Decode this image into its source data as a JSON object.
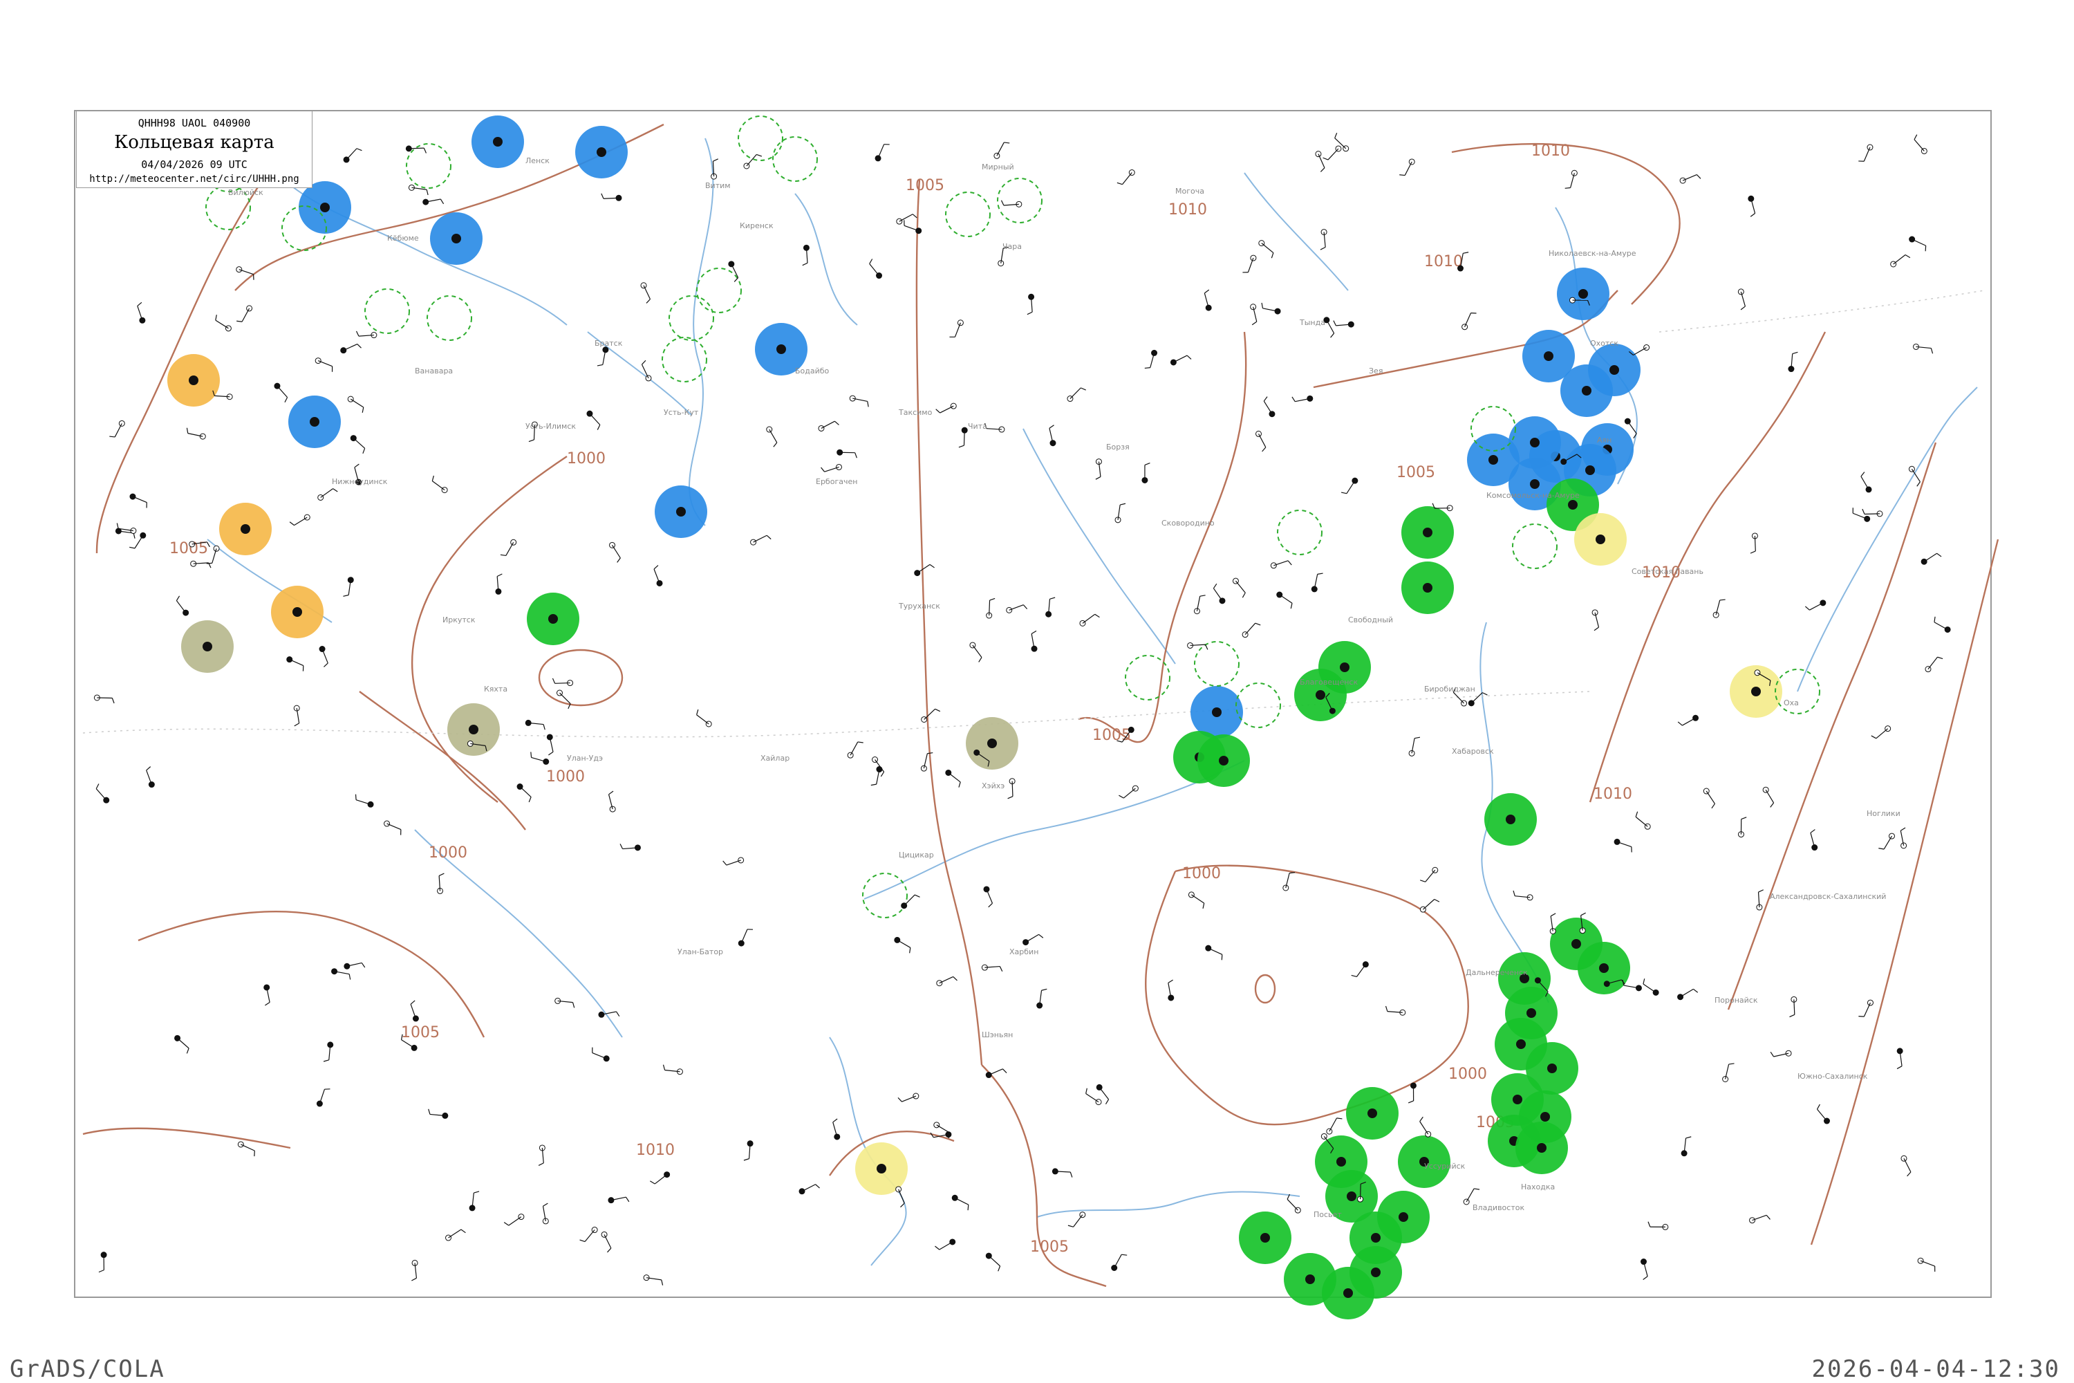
{
  "header": {
    "code_line": "QHHH98  UAOL  040900",
    "title": "Кольцевая карта",
    "date_line": "04/04/2026 09 UTC",
    "url": "http://meteocenter.net/circ/UHHH.png"
  },
  "footer": {
    "left": "GrADS/COLA",
    "right": "2026-04-04-12:30"
  },
  "colors": {
    "isobar": "#b8735a",
    "river": "#8ab8e0",
    "frame": "#999999",
    "circle_blue": "#2b8ce6",
    "circle_green": "#17c22a",
    "circle_orange": "#f5b84a",
    "circle_yellow": "#f4ec8c",
    "circle_olive": "#b7b98e",
    "dashed_green": "#2fae2f"
  },
  "isobar_labels": [
    "1010",
    "1010",
    "1010",
    "1005",
    "1005",
    "1005",
    "1005",
    "1000",
    "1000",
    "1000",
    "1000",
    "1005",
    "1010",
    "1005",
    "1010",
    "1005",
    "1000",
    "1010"
  ],
  "place_labels": [
    "Вилюйск",
    "Кёбюме",
    "Ленск",
    "Витим",
    "Мирный",
    "Бодайбо",
    "Таксимо",
    "Чара",
    "Могоча",
    "Чита",
    "Борзя",
    "Сковородино",
    "Тында",
    "Зея",
    "Свободный",
    "Благовещенск",
    "Биробиджан",
    "Хабаровск",
    "Николаевск-на-Амуре",
    "Охотск",
    "Аян",
    "Комсомольск-на-Амуре",
    "Советская Гавань",
    "Оха",
    "Ноглики",
    "Александровск-Сахалинский",
    "Поронайск",
    "Южно-Сахалинск",
    "Владивосток",
    "Уссурийск",
    "Находка",
    "Дальнереченск",
    "Посьет",
    "Шэньян",
    "Харбин",
    "Цицикар",
    "Хэйхэ",
    "Хайлар",
    "Улан-Батор",
    "Улан-Удэ",
    "Кяхта",
    "Иркутск",
    "Нижнеудинск",
    "Братск",
    "Киренск",
    "Усть-Кут",
    "Ербогачен",
    "Туруханск",
    "Ванавара",
    "Усть-Илимск"
  ],
  "highlight_circles": {
    "blue": 18,
    "green": 28,
    "orange": 3,
    "yellow": 3,
    "olive": 3
  }
}
